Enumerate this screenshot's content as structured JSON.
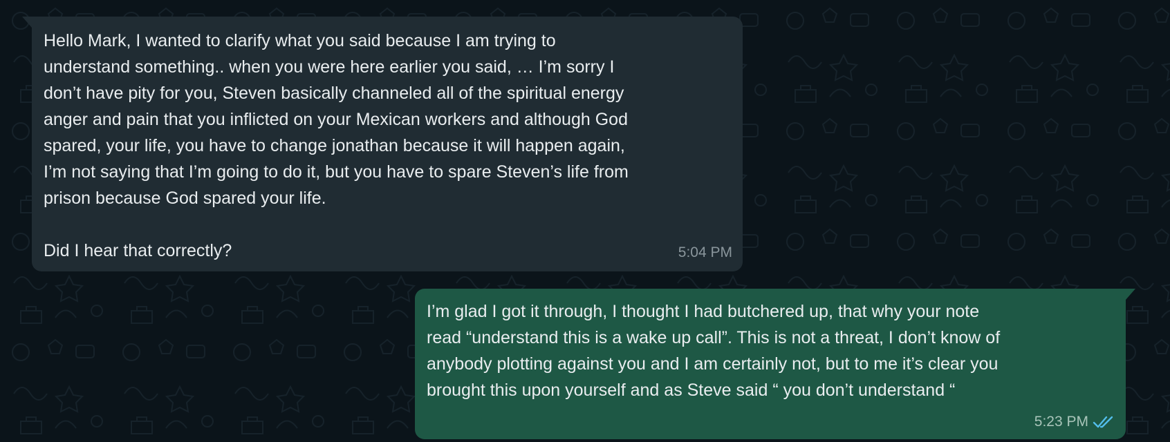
{
  "messages": {
    "incoming": {
      "lines": [
        "Hello Mark, I wanted to clarify what you said because I am trying to",
        "understand something.. when you were here earlier you said, … I’m sorry I",
        "don’t have pity for you, Steven basically channeled all of the spiritual energy",
        "anger and pain that you inflicted on your Mexican workers and although God",
        "spared, your life, you have to change jonathan because it will happen again,",
        "I’m not saying that I’m going to do it, but you have to spare Steven’s life from",
        "prison because God spared your life."
      ],
      "last_line": "Did I hear that correctly?",
      "time": "5:04 PM"
    },
    "outgoing": {
      "lines": [
        "I’m glad I got it through, I thought I had butchered up, that why your note",
        "read “understand this is a wake up call”. This is not a threat, I don’t know of",
        "anybody plotting against you and I am certainly not, but to me it’s clear you",
        "brought this upon yourself and as Steve said “ you don’t understand “"
      ],
      "time": "5:23 PM",
      "status_icon": "double-check-read-icon",
      "status_color": "#53bdeb"
    }
  },
  "colors": {
    "background": "#0b141a",
    "incoming_bubble": "#202c33",
    "outgoing_bubble": "#1e5845",
    "text": "#e9edef"
  }
}
